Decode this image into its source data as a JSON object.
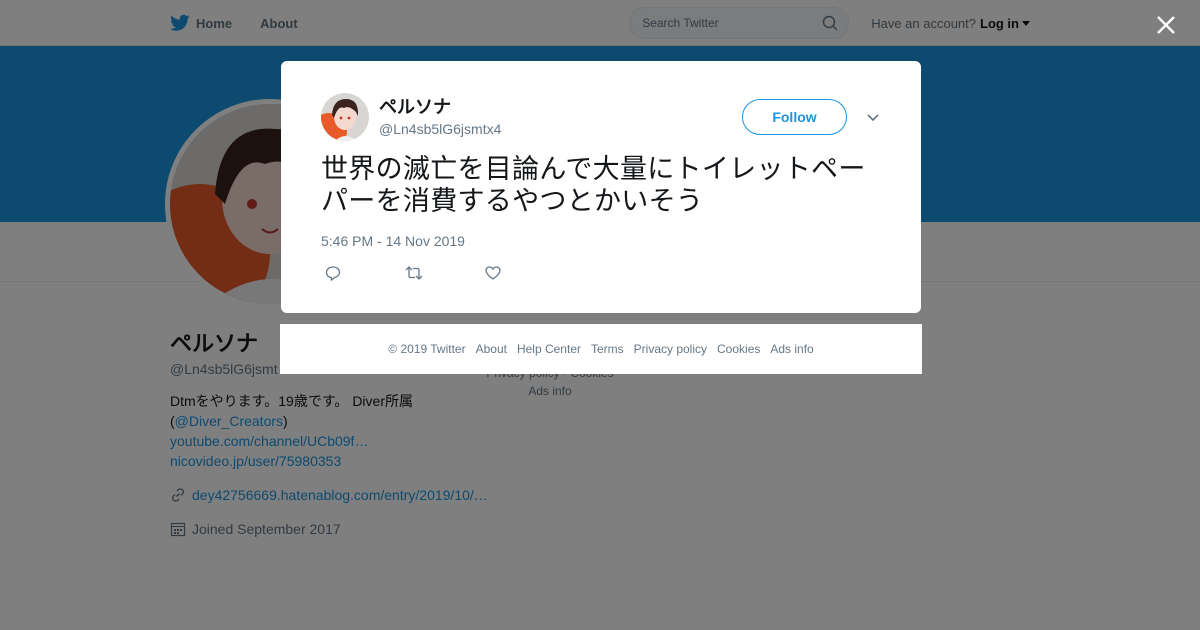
{
  "nav": {
    "home_label": "Home",
    "about_label": "About",
    "search_placeholder": "Search Twitter",
    "have_account": "Have an account?",
    "login_label": "Log in"
  },
  "colors": {
    "accent": "#1b95e0",
    "banner": "#1b95e0",
    "overlay": "rgba(0,0,0,0.5)"
  },
  "profile": {
    "name": "ペルソナ",
    "handle": "@Ln4sb5lG6jsmt",
    "bio_line1": "Dtmをやります。19歳です。 Diver所属",
    "bio_paren_open": "(",
    "bio_mention": "@Diver_Creators",
    "bio_paren_close": ")",
    "link_youtube": "youtube.com/channel/UCb09f…",
    "link_nico": "nicovideo.jp/user/75980353",
    "website": "dey42756669.hatenablog.com/entry/2019/10/…",
    "joined": "Joined September 2017"
  },
  "side_footer": {
    "line1": "Privacy policy · Cookies",
    "line2": "Ads info"
  },
  "tweet": {
    "name": "ペルソナ",
    "handle": "@Ln4sb5lG6jsmtx4",
    "follow_label": "Follow",
    "text": "世界の滅亡を目論んで大量にトイレットペーパーを消費するやつとかいそう",
    "timestamp": "5:46 PM - 14 Nov 2019",
    "icons": [
      "reply-icon",
      "retweet-icon",
      "like-icon"
    ]
  },
  "footer": {
    "copyright": "© 2019 Twitter",
    "items": [
      "About",
      "Help Center",
      "Terms",
      "Privacy policy",
      "Cookies",
      "Ads info"
    ]
  }
}
